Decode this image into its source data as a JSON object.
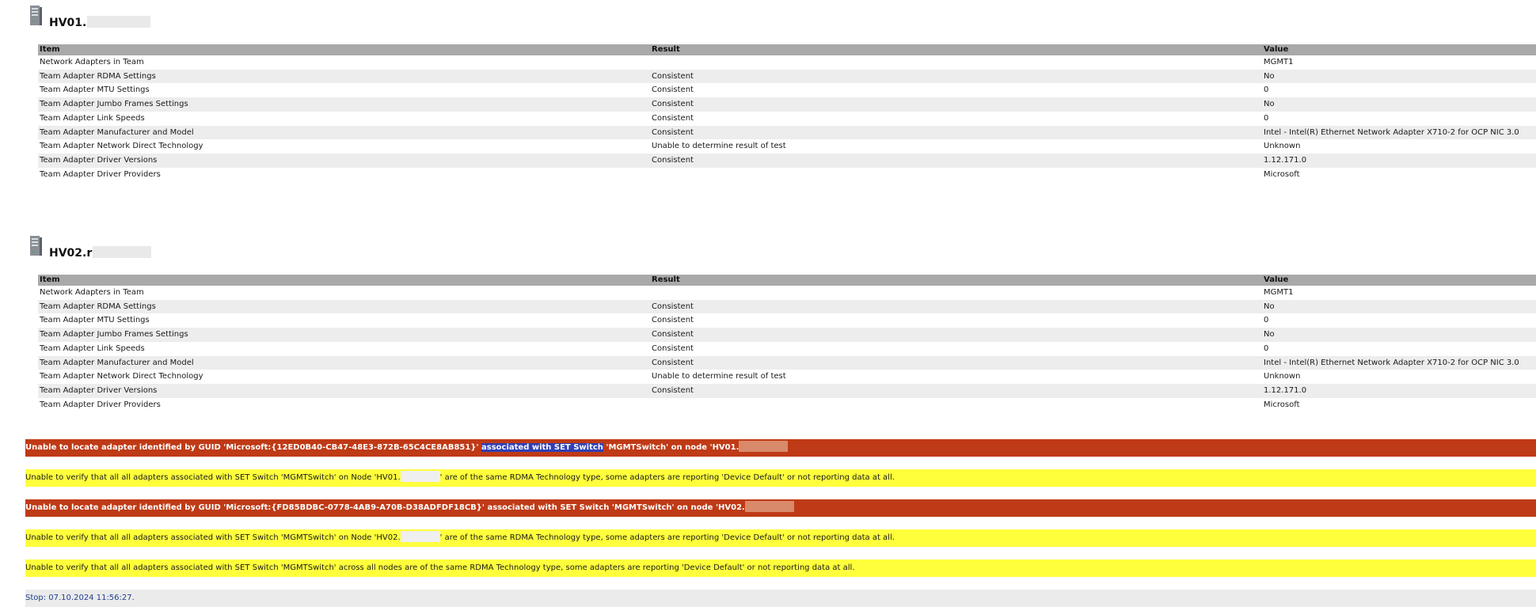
{
  "columns": [
    "Item",
    "Result",
    "Value"
  ],
  "nodes": [
    {
      "title": "HV01.",
      "rows": [
        [
          "Network Adapters in Team",
          "",
          "MGMT1"
        ],
        [
          "Team Adapter RDMA Settings",
          "Consistent",
          "No"
        ],
        [
          "Team Adapter MTU Settings",
          "Consistent",
          "0"
        ],
        [
          "Team Adapter Jumbo Frames Settings",
          "Consistent",
          "No"
        ],
        [
          "Team Adapter Link Speeds",
          "Consistent",
          "0"
        ],
        [
          "Team Adapter Manufacturer and Model",
          "Consistent",
          "Intel - Intel(R) Ethernet Network Adapter X710-2 for OCP NIC 3.0"
        ],
        [
          "Team Adapter Network Direct Technology",
          "Unable to determine result of test",
          "Unknown"
        ],
        [
          "Team Adapter Driver Versions",
          "Consistent",
          "1.12.171.0"
        ],
        [
          "Team Adapter Driver Providers",
          "",
          "Microsoft"
        ]
      ]
    },
    {
      "title": "HV02.r",
      "rows": [
        [
          "Network Adapters in Team",
          "",
          "MGMT1"
        ],
        [
          "Team Adapter RDMA Settings",
          "Consistent",
          "No"
        ],
        [
          "Team Adapter MTU Settings",
          "Consistent",
          "0"
        ],
        [
          "Team Adapter Jumbo Frames Settings",
          "Consistent",
          "No"
        ],
        [
          "Team Adapter Link Speeds",
          "Consistent",
          "0"
        ],
        [
          "Team Adapter Manufacturer and Model",
          "Consistent",
          "Intel - Intel(R) Ethernet Network Adapter X710-2 for OCP NIC 3.0"
        ],
        [
          "Team Adapter Network Direct Technology",
          "Unable to determine result of test",
          "Unknown"
        ],
        [
          "Team Adapter Driver Versions",
          "Consistent",
          "1.12.171.0"
        ],
        [
          "Team Adapter Driver Providers",
          "",
          "Microsoft"
        ]
      ]
    }
  ],
  "messages": {
    "error1_a": "Unable to locate adapter identified by GUID 'Microsoft:{12ED0B40-CB47-48E3-872B-65C4CE8AB851}' ",
    "error1_hl": "associated with SET Switch",
    "error1_b": " 'MGMTSwitch' on node 'HV01.",
    "warn1_a": "Unable to verify that all all adapters associated with SET Switch 'MGMTSwitch' on Node 'HV01.",
    "warn1_b": "' are of the same RDMA Technology type, some adapters are reporting 'Device Default' or not reporting data at all.",
    "error2": "Unable to locate adapter identified by GUID 'Microsoft:{FD85BDBC-0778-4AB9-A70B-D38ADFDF18CB}' associated with SET Switch 'MGMTSwitch' on node 'HV02.",
    "warn2_a": "Unable to verify that all all adapters associated with SET Switch 'MGMTSwitch' on Node 'HV02.",
    "warn2_b": "' are of the same RDMA Technology type, some adapters are reporting 'Device Default' or not reporting data at all.",
    "warn3": "Unable to verify that all all adapters associated with SET Switch 'MGMTSwitch' across all nodes are of the same RDMA Technology type, some adapters are reporting 'Device Default' or not reporting data at all.",
    "stop": "Stop: 07.10.2024 11:56:27."
  },
  "colors": {
    "error": "#bf3a16",
    "warning": "#ffff3c",
    "header": "#a9a9a9",
    "stop_text": "#1f3f8f"
  },
  "icons": [
    "server-icon"
  ]
}
